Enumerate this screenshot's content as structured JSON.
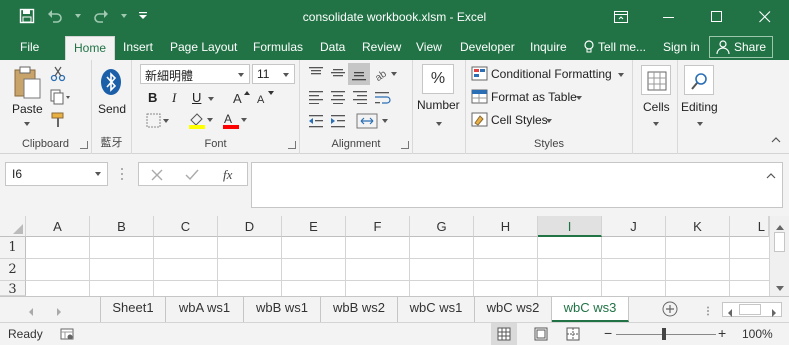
{
  "window": {
    "title": "consolidate workbook.xlsm - Excel"
  },
  "tabs": [
    {
      "label": "File"
    },
    {
      "label": "Home"
    },
    {
      "label": "Insert"
    },
    {
      "label": "Page Layout"
    },
    {
      "label": "Formulas"
    },
    {
      "label": "Data"
    },
    {
      "label": "Review"
    },
    {
      "label": "View"
    },
    {
      "label": "Developer"
    },
    {
      "label": "Inquire"
    }
  ],
  "tell_me": "Tell me...",
  "sign_in": "Sign in",
  "share": "Share",
  "ribbon": {
    "clipboard": {
      "paste": "Paste",
      "label": "Clipboard"
    },
    "bluetooth": {
      "send": "Send",
      "label": "藍牙"
    },
    "font": {
      "name": "新細明體",
      "size": "11",
      "label": "Font",
      "bold": "B",
      "italic": "I",
      "underline": "U"
    },
    "alignment": {
      "label": "Alignment"
    },
    "number": {
      "symbol": "%",
      "label": "Number"
    },
    "styles": {
      "conditional": "Conditional Formatting",
      "format_table": "Format as Table",
      "cell_styles": "Cell Styles",
      "label": "Styles"
    },
    "cells": {
      "label": "Cells"
    },
    "editing": {
      "label": "Editing"
    }
  },
  "formula_bar": {
    "name_box": "I6",
    "fx": "fx",
    "value": ""
  },
  "grid": {
    "columns": [
      "A",
      "B",
      "C",
      "D",
      "E",
      "F",
      "G",
      "H",
      "I",
      "J",
      "K",
      "L"
    ],
    "rows": [
      "1",
      "2",
      "3"
    ],
    "selected_column": "I"
  },
  "sheets": [
    {
      "name": "Sheet1"
    },
    {
      "name": "wbA ws1"
    },
    {
      "name": "wbB ws1"
    },
    {
      "name": "wbB ws2"
    },
    {
      "name": "wbC ws1"
    },
    {
      "name": "wbC ws2"
    },
    {
      "name": "wbC ws3"
    }
  ],
  "status": {
    "ready": "Ready",
    "zoom": "100%"
  },
  "colors": {
    "brand": "#217346",
    "font_highlight": "#ffff00",
    "font_color": "#ff0000"
  }
}
